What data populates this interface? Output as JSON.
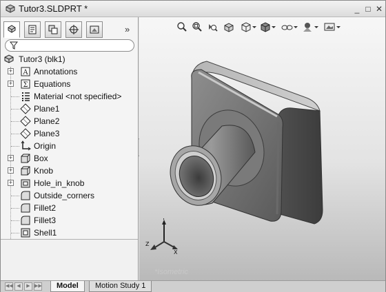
{
  "window": {
    "title": "Tutor3.SLDPRT *"
  },
  "window_controls": {
    "minimize": "_",
    "restore": "□",
    "close": "✕"
  },
  "feature_manager": {
    "tabs": [
      {
        "icon": "featuremanager-tree-icon"
      },
      {
        "icon": "propertymanager-icon"
      },
      {
        "icon": "configurationmanager-icon"
      },
      {
        "icon": "dimxpert-icon"
      },
      {
        "icon": "display-manager-icon"
      }
    ],
    "more_label": "»",
    "filter_icon": "filter-icon",
    "root": {
      "label": "Tutor3  (blk1)"
    },
    "items": [
      {
        "label": "Annotations",
        "icon": "annotations-icon",
        "expandable": true
      },
      {
        "label": "Equations",
        "icon": "equations-icon",
        "expandable": true
      },
      {
        "label": "Material <not specified>",
        "icon": "material-icon",
        "expandable": false
      },
      {
        "label": "Plane1",
        "icon": "plane-icon",
        "expandable": false
      },
      {
        "label": "Plane2",
        "icon": "plane-icon",
        "expandable": false
      },
      {
        "label": "Plane3",
        "icon": "plane-icon",
        "expandable": false
      },
      {
        "label": "Origin",
        "icon": "origin-icon",
        "expandable": false
      },
      {
        "label": "Box",
        "icon": "extrude-icon",
        "expandable": true
      },
      {
        "label": "Knob",
        "icon": "extrude-icon",
        "expandable": true
      },
      {
        "label": "Hole_in_knob",
        "icon": "cut-extrude-icon",
        "expandable": true
      },
      {
        "label": "Outside_corners",
        "icon": "fillet-icon",
        "expandable": false
      },
      {
        "label": "Fillet2",
        "icon": "fillet-icon",
        "expandable": false
      },
      {
        "label": "Fillet3",
        "icon": "fillet-icon",
        "expandable": false
      },
      {
        "label": "Shell1",
        "icon": "shell-icon",
        "expandable": false
      }
    ]
  },
  "view_toolbar": {
    "buttons": [
      "zoom-to-fit-icon",
      "zoom-to-area-icon",
      "previous-view-icon",
      "section-view-icon",
      "view-orientation-icon",
      "display-style-icon",
      "hide-show-items-icon",
      "edit-appearance-icon",
      "apply-scene-icon"
    ]
  },
  "graphics": {
    "view_label": "*Isometric"
  },
  "triad": {
    "x": "X",
    "y": "Y",
    "z": "Z"
  },
  "bottom_tabs": [
    {
      "label": "Model",
      "active": true
    },
    {
      "label": "Motion Study 1",
      "active": false
    }
  ]
}
